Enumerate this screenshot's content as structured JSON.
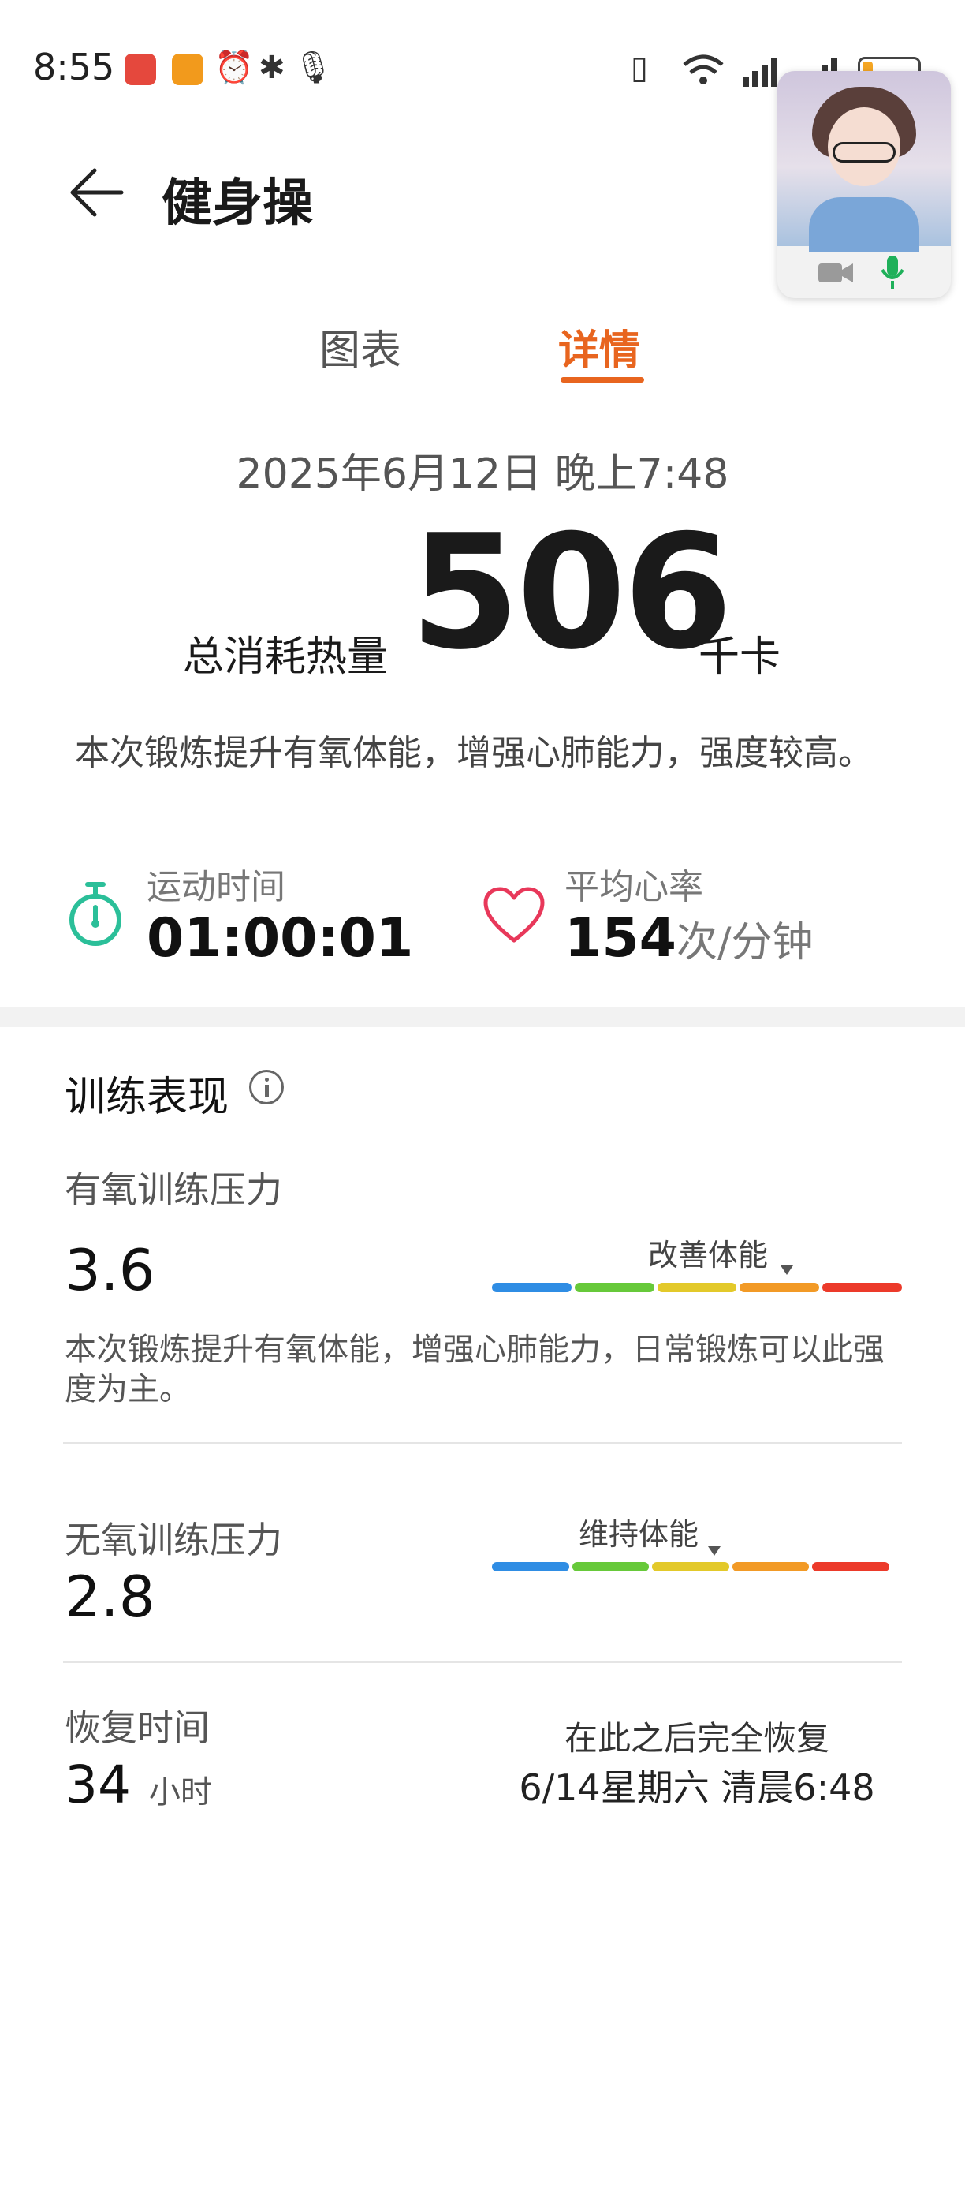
{
  "status_bar": {
    "time": "8:55",
    "battery_level": 0.18,
    "battery_color": "#f5a623"
  },
  "header": {
    "title": "健身操"
  },
  "tabs": [
    {
      "label": "图表",
      "active": false
    },
    {
      "label": "详情",
      "active": true
    }
  ],
  "accent_color": "#e8651f",
  "workout": {
    "datetime": "2025年6月12日 晚上7:48",
    "calories_label": "总消耗热量",
    "calories_value": "506",
    "calories_unit": "千卡",
    "summary": "本次锻炼提升有氧体能，增强心肺能力，强度较高。",
    "duration_label": "运动时间",
    "duration_value": "01:00:01",
    "heart_rate_label": "平均心率",
    "heart_rate_value": "154",
    "heart_rate_unit": "次/分钟"
  },
  "performance": {
    "title": "训练表现",
    "aerobic": {
      "label": "有氧训练压力",
      "value": "3.6",
      "level_label": "改善体能",
      "level": 3.6,
      "description": "本次锻炼提升有氧体能，增强心肺能力，日常锻炼可以此强度为主。"
    },
    "anaerobic": {
      "label": "无氧训练压力",
      "value": "2.8",
      "level_label": "维持体能",
      "level": 2.8
    },
    "scale_colors": [
      "#2f8de4",
      "#67c93a",
      "#e3c92a",
      "#f29a26",
      "#ec3a2a"
    ],
    "recovery": {
      "label": "恢复时间",
      "value": "34",
      "unit": "小时",
      "note": "在此之后完全恢复",
      "until": "6/14星期六 清晨6:48"
    }
  }
}
